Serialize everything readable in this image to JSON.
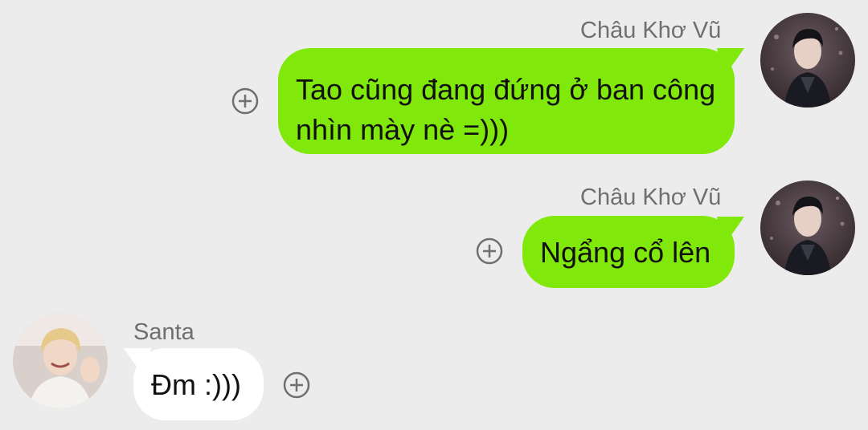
{
  "messages": [
    {
      "sender": "Châu Khơ Vũ",
      "text_line1": "Tao cũng đang đứng ở ban công",
      "text_line2": "nhìn mày nè =)))",
      "direction": "outgoing",
      "avatar_icon": "user-avatar-photo"
    },
    {
      "sender": "Châu Khơ Vũ",
      "text": "Ngẩng cổ lên",
      "direction": "outgoing",
      "avatar_icon": "user-avatar-photo"
    },
    {
      "sender": "Santa",
      "text": "Đm :)))",
      "direction": "incoming",
      "avatar_icon": "user-avatar-photo"
    }
  ],
  "icons": {
    "add_reaction": "plus-circle-icon"
  },
  "colors": {
    "background": "#ececec",
    "outgoing_bubble": "#80e80a",
    "incoming_bubble": "#ffffff",
    "name_text": "#6f6f6f"
  }
}
